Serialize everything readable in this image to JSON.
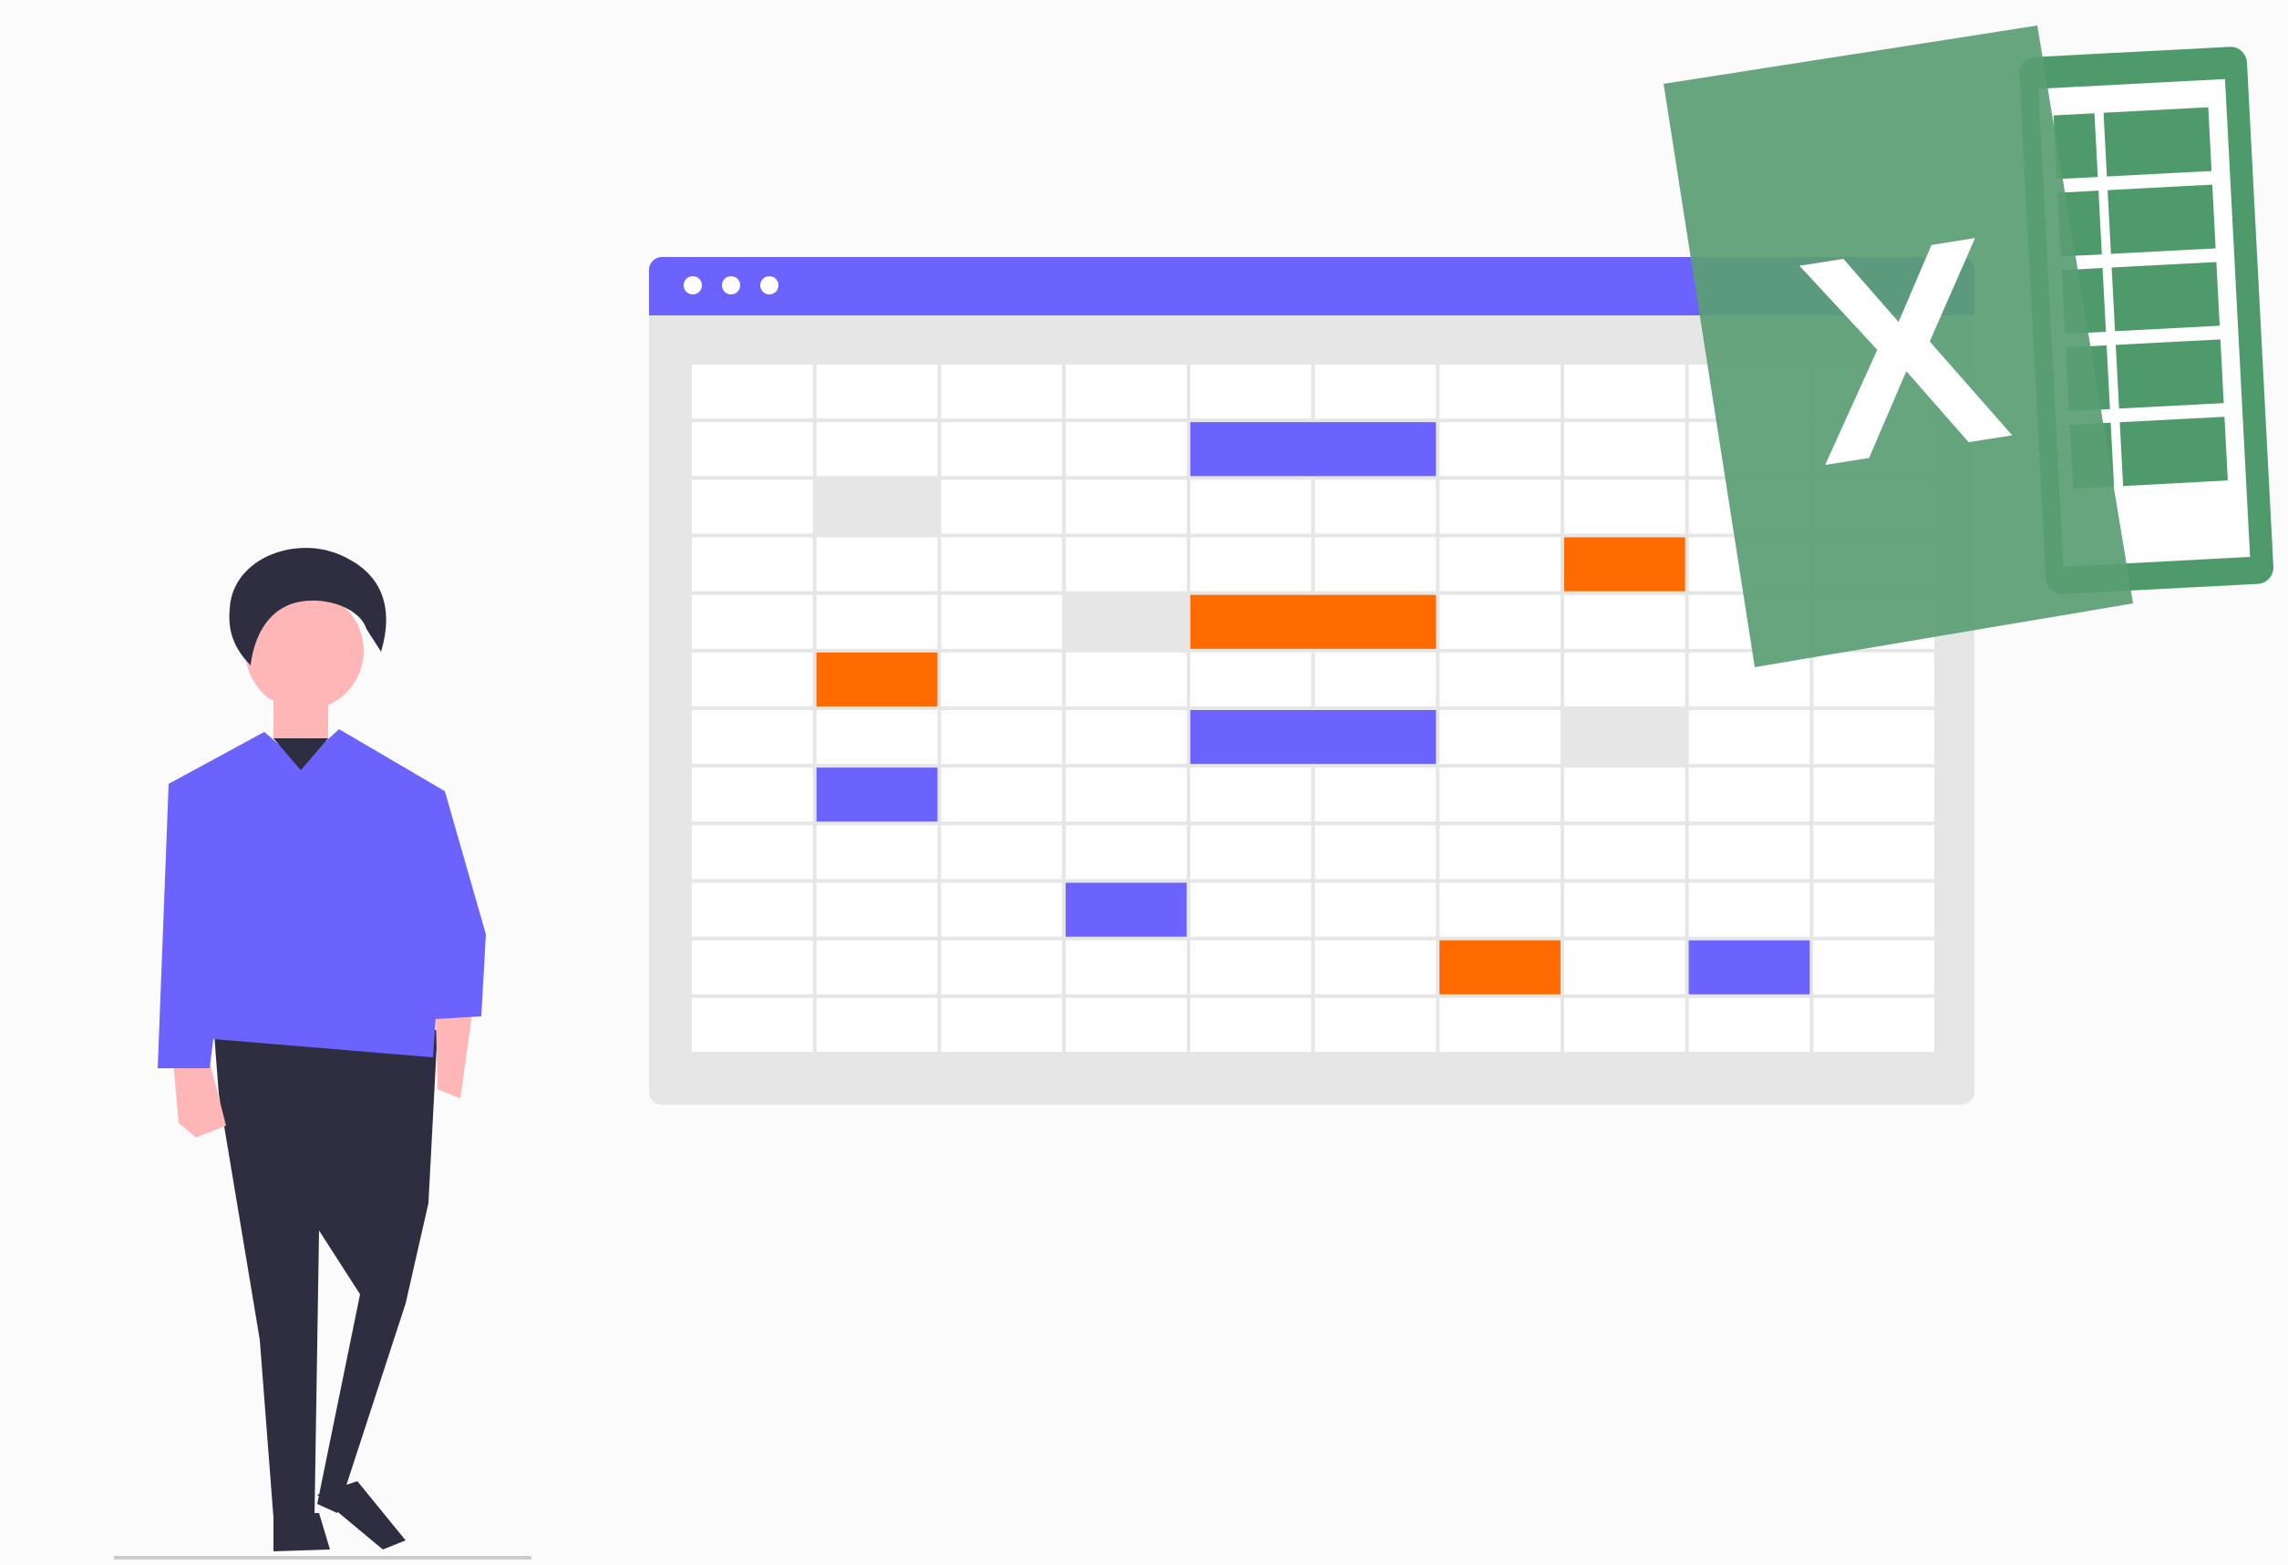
{
  "colors": {
    "background": "#fbfbfb",
    "accent_purple": "#6c63ff",
    "accent_orange": "#ff6b00",
    "cell_gray": "#e6e6e6",
    "frame_gray": "#e6e6e6",
    "grid_line": "#e6e6e6",
    "cell_white": "#ffffff",
    "skin": "#ffb6b6",
    "hair": "#2f2e41",
    "pants": "#2f2e41",
    "excel_green_front": "#5a9e74",
    "excel_green_back": "#4f9a6a",
    "excel_logo_text": "#ffffff"
  },
  "icons": {
    "window_dots": "window-controls-icon",
    "logo": "excel-logo-icon",
    "figure": "person-illustration"
  },
  "excel_logo": {
    "letter": "X"
  },
  "spreadsheet": {
    "columns": 10,
    "rows": 12,
    "highlighted_cells": [
      {
        "row": 1,
        "col": 4,
        "span": 2,
        "color": "purple"
      },
      {
        "row": 2,
        "col": 1,
        "span": 1,
        "color": "gray"
      },
      {
        "row": 3,
        "col": 7,
        "span": 1,
        "color": "orange"
      },
      {
        "row": 4,
        "col": 3,
        "span": 1,
        "color": "gray"
      },
      {
        "row": 4,
        "col": 4,
        "span": 2,
        "color": "orange"
      },
      {
        "row": 5,
        "col": 1,
        "span": 1,
        "color": "orange"
      },
      {
        "row": 6,
        "col": 4,
        "span": 2,
        "color": "purple"
      },
      {
        "row": 6,
        "col": 7,
        "span": 1,
        "color": "gray"
      },
      {
        "row": 7,
        "col": 1,
        "span": 1,
        "color": "purple"
      },
      {
        "row": 9,
        "col": 3,
        "span": 1,
        "color": "purple"
      },
      {
        "row": 10,
        "col": 6,
        "span": 1,
        "color": "orange"
      },
      {
        "row": 10,
        "col": 8,
        "span": 1,
        "color": "purple"
      }
    ]
  }
}
